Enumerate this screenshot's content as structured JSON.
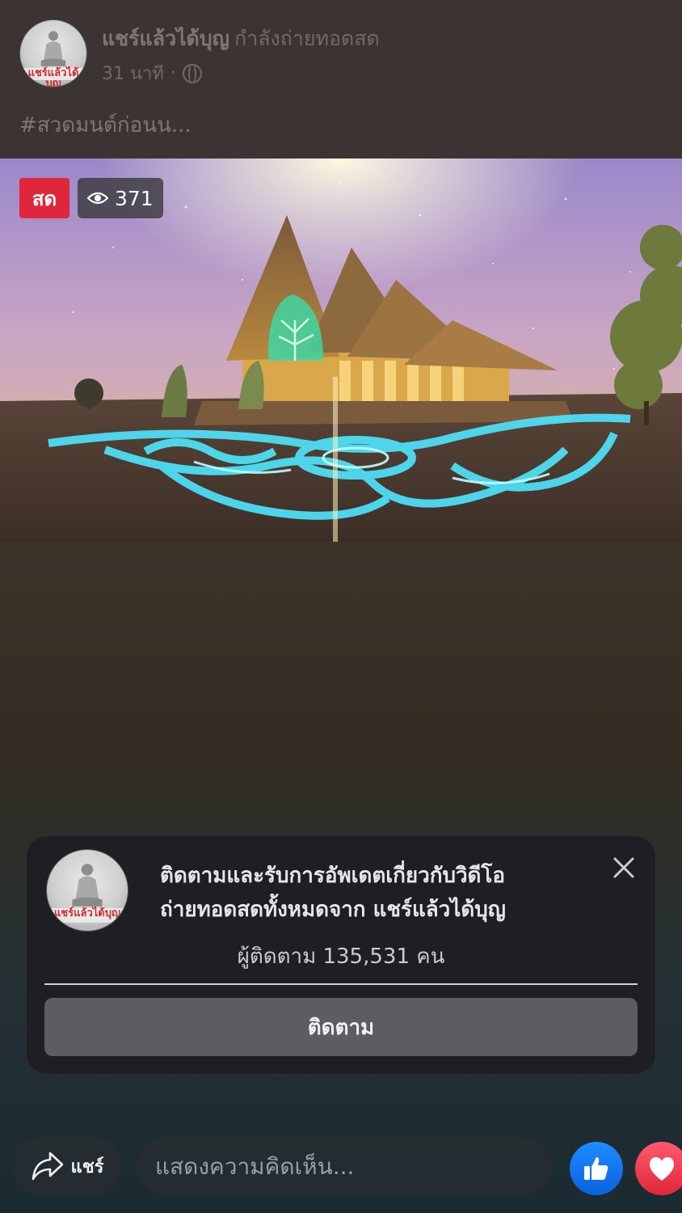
{
  "header": {
    "page_name": "แชร์แล้วได้บุญ",
    "status": "กำลังถ่ายทอดสด",
    "time": "31 นาที",
    "separator": "·",
    "caption": "#สวดมนต์ก่อนน...",
    "avatar_text": "แชร์แล้วได้บุญ"
  },
  "video": {
    "live_label": "สด",
    "viewer_count": "371"
  },
  "follow_card": {
    "title": "ติดตามและรับการอัพเดตเกี่ยวกับวิดีโอถ่ายทอดสดทั้งหมดจาก แชร์แล้วได้บุญ",
    "followers": "ผู้ติดตาม 135,531 คน",
    "follow_button": "ติดตาม",
    "avatar_text": "แชร์แล้วได้บุญ"
  },
  "bottom_bar": {
    "share_label": "แชร์",
    "comment_placeholder": "แสดงความคิดเห็น..."
  },
  "colors": {
    "live_red": "#e0263a",
    "like_blue": "#1877f2",
    "love_red": "#f33e58"
  },
  "icons": [
    "globe-icon",
    "eye-icon",
    "close-icon",
    "share-arrow-icon",
    "like-icon",
    "love-icon"
  ]
}
